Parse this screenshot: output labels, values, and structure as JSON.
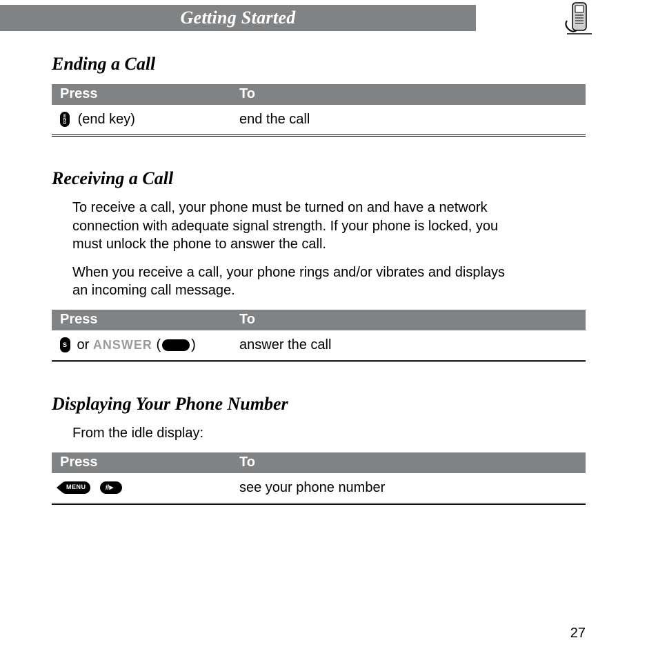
{
  "header": {
    "title": "Getting Started"
  },
  "page_number": "27",
  "sections": {
    "ending": {
      "heading": "Ending a Call",
      "table": {
        "col_press": "Press",
        "col_to": "To",
        "row0_press_suffix": "(end key)",
        "row0_to": "end the call"
      }
    },
    "receiving": {
      "heading": "Receiving a Call",
      "p1": "To receive a call, your phone must be turned on and have a network connection with adequate signal strength. If your phone is locked, you must unlock the phone to answer the call.",
      "p2": "When you receive a call, your phone rings and/or vibrates and displays an incoming call message.",
      "table": {
        "col_press": "Press",
        "col_to": "To",
        "row0_or": " or ",
        "row0_answer_label": "ANSWER",
        "row0_to": "answer the call"
      }
    },
    "displaying": {
      "heading": "Displaying Your Phone Number",
      "p1": "From the idle display:",
      "table": {
        "col_press": "Press",
        "col_to": "To",
        "row0_to": "see your phone number"
      }
    }
  }
}
